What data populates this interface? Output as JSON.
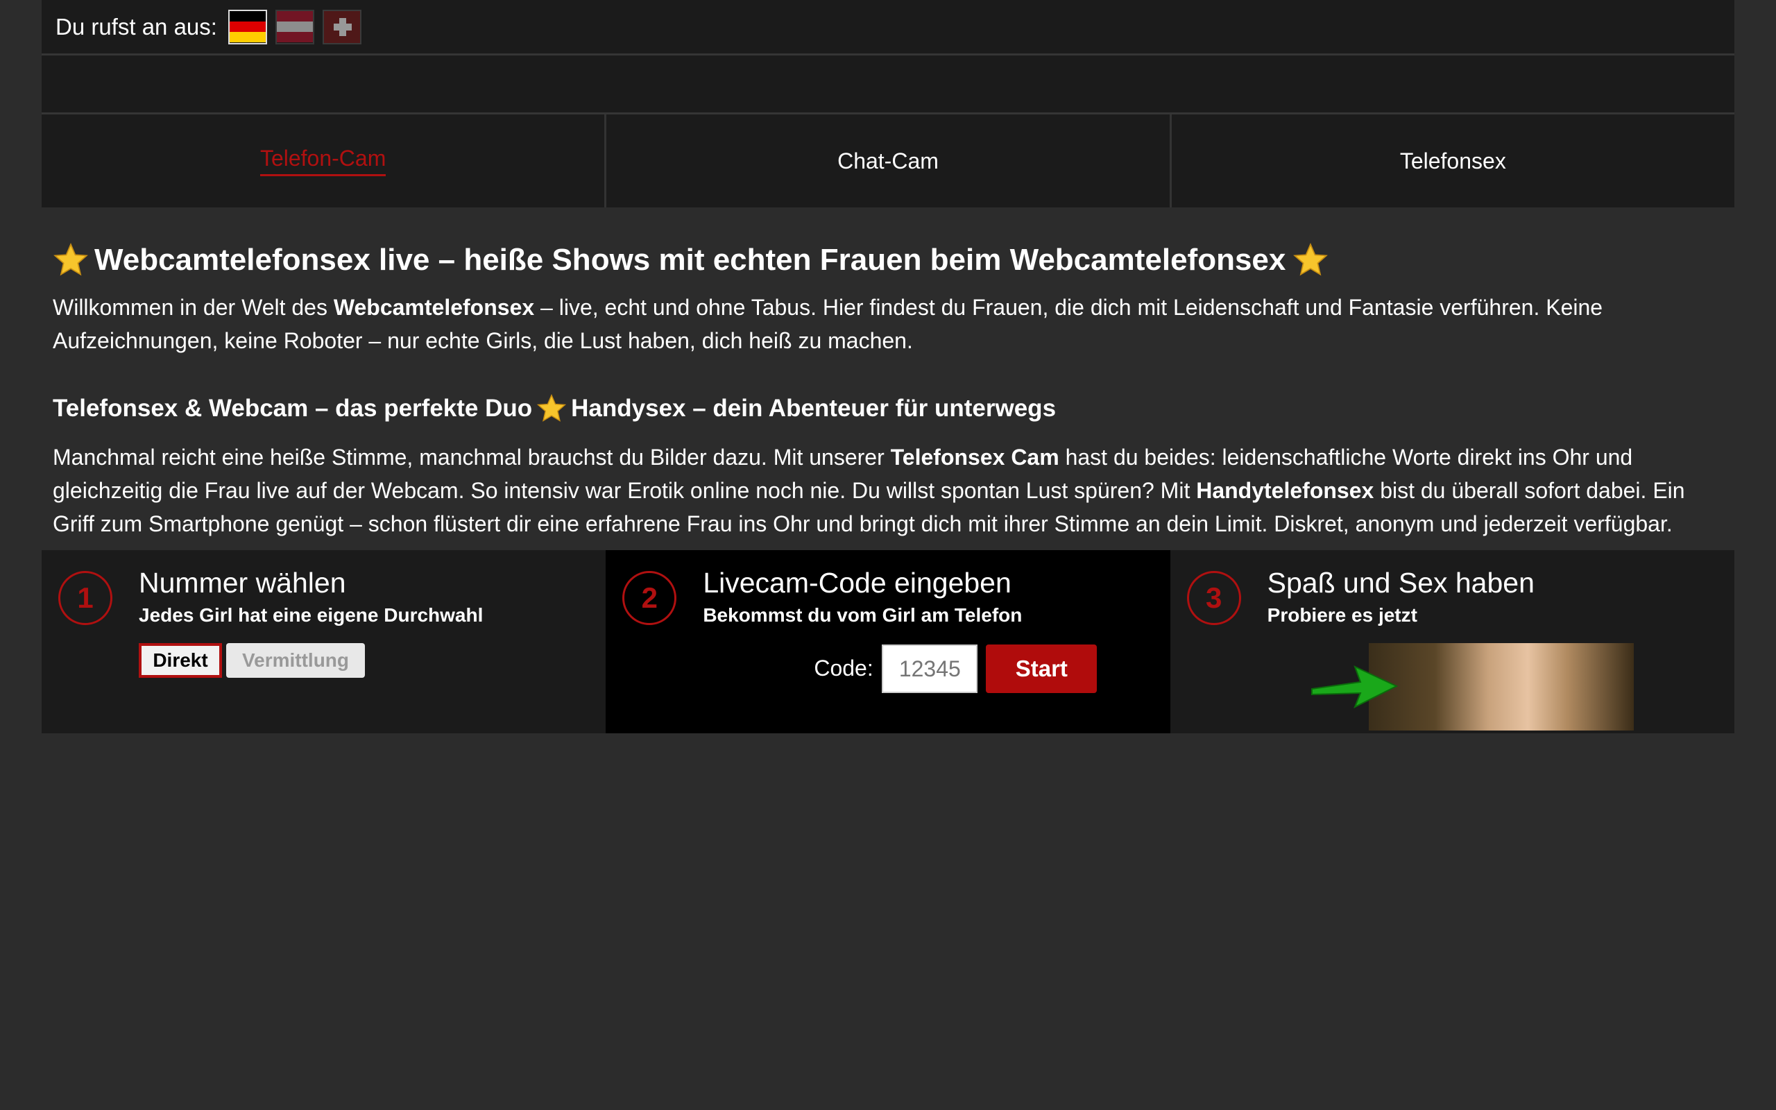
{
  "topbar": {
    "label": "Du rufst an aus:",
    "flags": [
      "germany-flag",
      "austria-flag",
      "switzerland-flag"
    ]
  },
  "tabs": [
    {
      "label": "Telefon-Cam",
      "active": true
    },
    {
      "label": "Chat-Cam",
      "active": false
    },
    {
      "label": "Telefonsex",
      "active": false
    }
  ],
  "colors": {
    "accent": "#b01010",
    "background": "#2c2c2c",
    "panel": "#1b1b1b"
  },
  "main": {
    "heading": "Webcamtelefonsex live – heiße Shows mit echten Frauen beim Webcamtelefonsex",
    "intro_pre": "Willkommen in der Welt des ",
    "intro_bold": "Webcamtelefonsex",
    "intro_post": " – live, echt und ohne Tabus. Hier findest du Frauen, die dich mit Leidenschaft und Fantasie verführen. Keine Aufzeichnungen, keine Roboter – nur echte Girls, die Lust haben, dich heiß zu machen.",
    "subheading_a": "Telefonsex & Webcam – das perfekte Duo",
    "subheading_b": "Handysex – dein Abenteuer für unterwegs",
    "body_1": "Manchmal reicht eine heiße Stimme, manchmal brauchst du Bilder dazu. Mit unserer ",
    "body_bold_1": "Telefonsex Cam",
    "body_2": " hast du beides: leidenschaftliche Worte direkt ins Ohr und gleichzeitig die Frau live auf der Webcam. So intensiv war Erotik online noch nie. Du willst spontan Lust spüren? Mit ",
    "body_bold_2": "Handytelefonsex",
    "body_3": " bist du überall sofort dabei. Ein Griff zum Smartphone genügt – schon flüstert dir eine erfahrene Frau ins Ohr und bringt dich mit ihrer Stimme an dein Limit. Diskret, anonym und jederzeit verfügbar."
  },
  "steps": [
    {
      "number": "1",
      "title": "Nummer wählen",
      "subtitle": "Jedes Girl hat eine eigene Durchwahl",
      "button_direct": "Direkt",
      "button_agency": "Vermittlung"
    },
    {
      "number": "2",
      "title": "Livecam-Code eingeben",
      "subtitle": "Bekommst du vom Girl am Telefon",
      "code_label": "Code:",
      "code_placeholder": "12345",
      "start_label": "Start"
    },
    {
      "number": "3",
      "title": "Spaß und Sex haben",
      "subtitle": "Probiere es jetzt",
      "icons": [
        "green-arrow-icon",
        "promo-image"
      ]
    }
  ]
}
